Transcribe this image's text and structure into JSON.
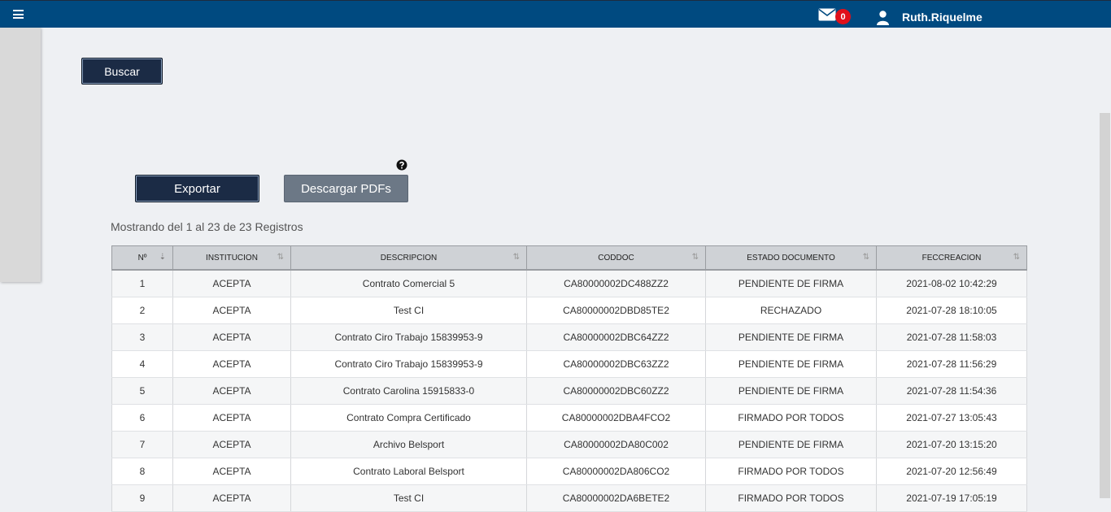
{
  "header": {
    "menu_icon": "hamburger-menu-icon",
    "mail_icon": "envelope-icon",
    "notification_count": "0",
    "user_icon": "user-icon",
    "username": "Ruth.Riquelme"
  },
  "actions": {
    "search_label": "Buscar",
    "export_label": "Exportar",
    "download_pdfs_label": "Descargar PDFs",
    "help_icon": "question-circle-icon"
  },
  "table": {
    "showing_text": "Mostrando del 1 al 23 de 23 Registros",
    "columns": [
      "Nº",
      "INSTITUCION",
      "DESCRIPCION",
      "CODDOC",
      "ESTADO DOCUMENTO",
      "FECCREACION"
    ],
    "rows": [
      [
        "1",
        "ACEPTA",
        "Contrato Comercial 5",
        "CA80000002DC488ZZ2",
        "PENDIENTE DE FIRMA",
        "2021-08-02 10:42:29"
      ],
      [
        "2",
        "ACEPTA",
        "Test CI",
        "CA80000002DBD85TE2",
        "RECHAZADO",
        "2021-07-28 18:10:05"
      ],
      [
        "3",
        "ACEPTA",
        "Contrato Ciro Trabajo 15839953-9",
        "CA80000002DBC64ZZ2",
        "PENDIENTE DE FIRMA",
        "2021-07-28 11:58:03"
      ],
      [
        "4",
        "ACEPTA",
        "Contrato Ciro Trabajo 15839953-9",
        "CA80000002DBC63ZZ2",
        "PENDIENTE DE FIRMA",
        "2021-07-28 11:56:29"
      ],
      [
        "5",
        "ACEPTA",
        "Contrato Carolina 15915833-0",
        "CA80000002DBC60ZZ2",
        "PENDIENTE DE FIRMA",
        "2021-07-28 11:54:36"
      ],
      [
        "6",
        "ACEPTA",
        "Contrato Compra Certificado",
        "CA80000002DBA4FCO2",
        "FIRMADO POR TODOS",
        "2021-07-27 13:05:43"
      ],
      [
        "7",
        "ACEPTA",
        "Archivo Belsport",
        "CA80000002DA80C002",
        "PENDIENTE DE FIRMA",
        "2021-07-20 13:15:20"
      ],
      [
        "8",
        "ACEPTA",
        "Contrato Laboral Belsport",
        "CA80000002DA806CO2",
        "FIRMADO POR TODOS",
        "2021-07-20 12:56:49"
      ],
      [
        "9",
        "ACEPTA",
        "Test CI",
        "CA80000002DA6BETE2",
        "FIRMADO POR TODOS",
        "2021-07-19 17:05:19"
      ]
    ]
  },
  "colors": {
    "topbar": "#004a80",
    "primary_button": "#1b2b45",
    "secondary_button": "#6c7886",
    "badge": "#e0101a"
  }
}
